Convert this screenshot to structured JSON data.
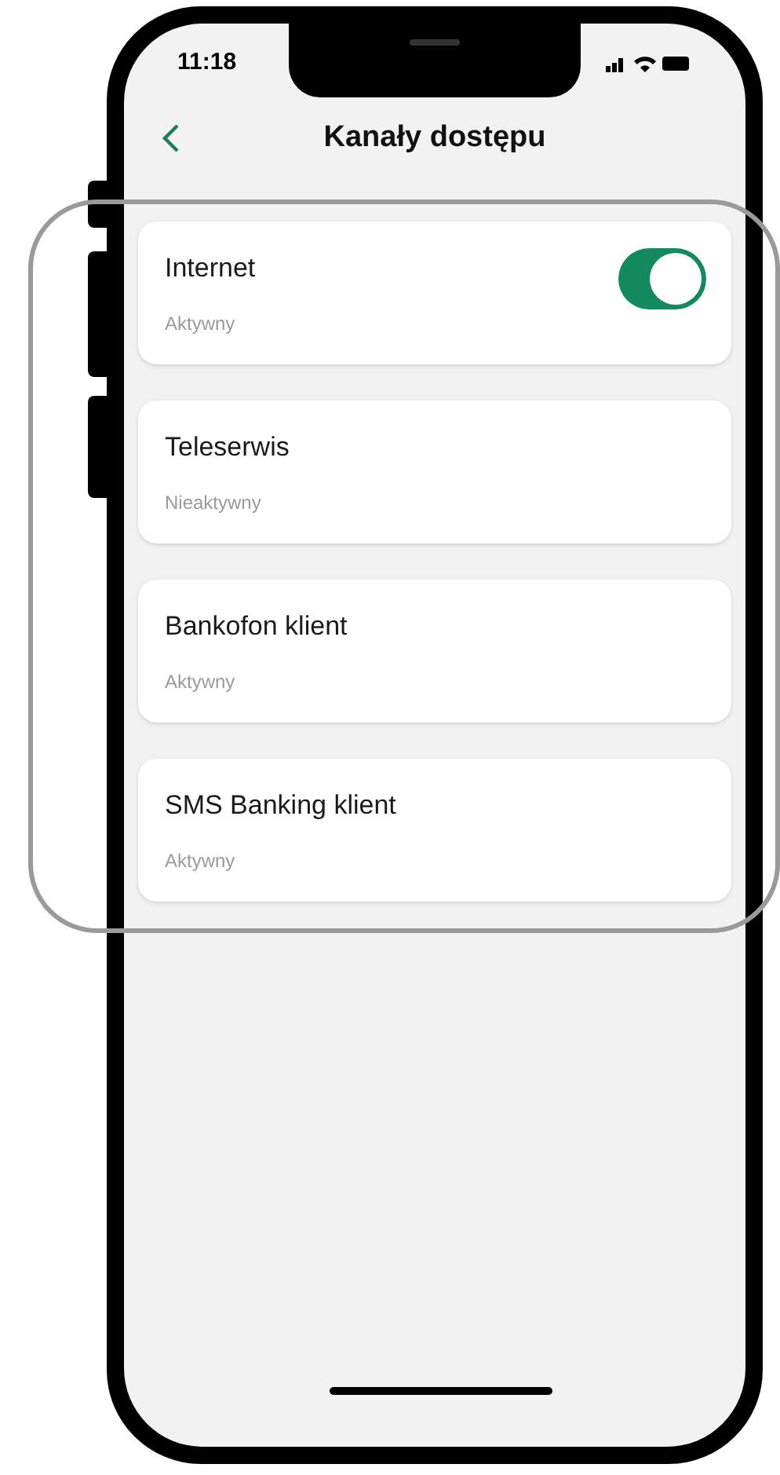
{
  "status_bar": {
    "time": "11:18"
  },
  "header": {
    "title": "Kanały dostępu"
  },
  "channels": [
    {
      "kind": "toggle",
      "name": "Internet",
      "status": "Aktywny",
      "on": true
    },
    {
      "kind": "plain",
      "name": "Teleserwis",
      "status": "Nieaktywny"
    },
    {
      "kind": "plain",
      "name": "Bankofon klient",
      "status": "Aktywny"
    },
    {
      "kind": "plain",
      "name": "SMS Banking klient",
      "status": "Aktywny"
    }
  ]
}
